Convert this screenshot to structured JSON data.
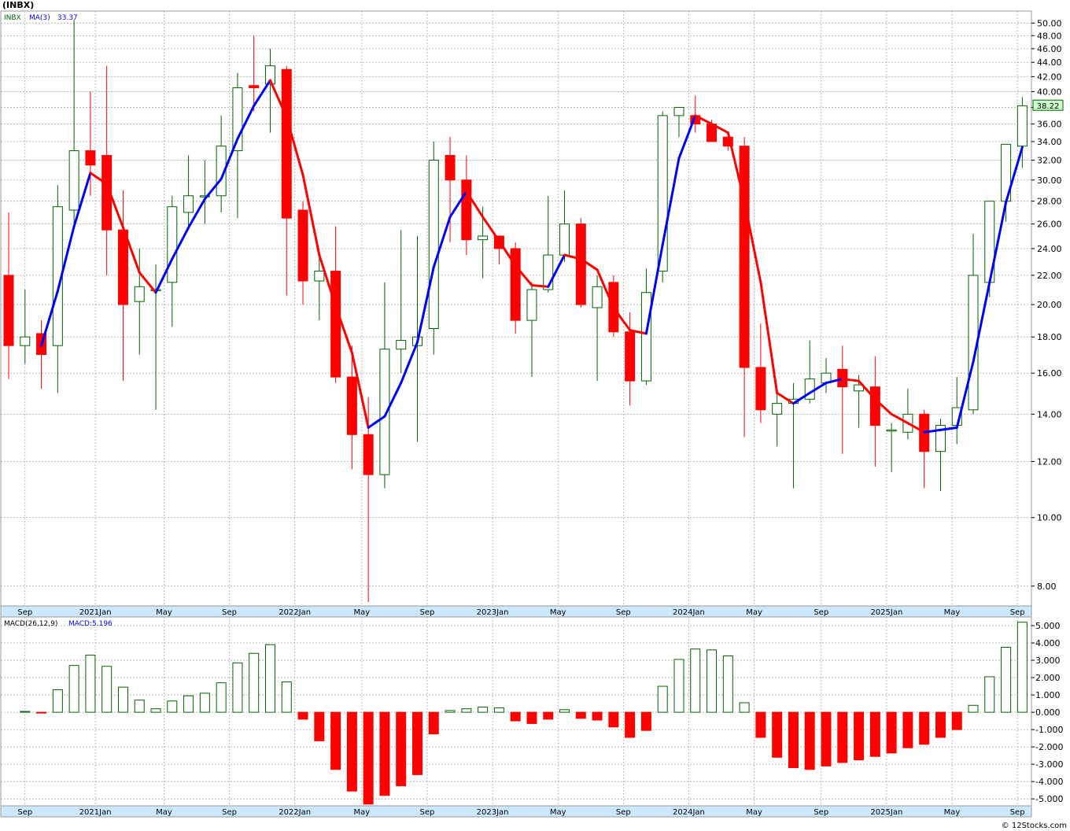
{
  "title": "(INBX)",
  "footer": "© 12Stocks.com",
  "price_panel": {
    "ticker": "INBX",
    "ma_label": "MA(3)",
    "ma_value": "33.37",
    "last_price": "38.22",
    "last_price_value": 38.22
  },
  "macd_panel": {
    "label": "MACD(26,12,9)",
    "value_label": "MACD:5.196"
  },
  "x_axis_labels": [
    {
      "label": "Sep",
      "index": 1
    },
    {
      "label": "2021Jan",
      "index": 5.3
    },
    {
      "label": "May",
      "index": 9.5
    },
    {
      "label": "Sep",
      "index": 13.5
    },
    {
      "label": "2022Jan",
      "index": 17.5
    },
    {
      "label": "May",
      "index": 21.6
    },
    {
      "label": "Sep",
      "index": 25.6
    },
    {
      "label": "2023Jan",
      "index": 29.6
    },
    {
      "label": "May",
      "index": 33.6
    },
    {
      "label": "Sep",
      "index": 37.6
    },
    {
      "label": "2024Jan",
      "index": 41.6
    },
    {
      "label": "May",
      "index": 45.6
    },
    {
      "label": "Sep",
      "index": 49.7
    },
    {
      "label": "2025Jan",
      "index": 53.7
    },
    {
      "label": "May",
      "index": 57.7
    },
    {
      "label": "Sep",
      "index": 61.7
    }
  ],
  "colors": {
    "up": "#006400",
    "down": "#ff0000",
    "ma_up": "#0000ff",
    "ma_down": "#ff0000",
    "grid": "#aaaaaa",
    "axis_band": "#cce8ff",
    "last_price_box": "#ccffcc"
  },
  "chart_data": [
    {
      "type": "candlestick",
      "title": "(INBX)",
      "y_scale": "log",
      "ylim": [
        7.5,
        52
      ],
      "yticks": [
        "8.00",
        "10.00",
        "12.00",
        "14.00",
        "16.00",
        "18.00",
        "20.00",
        "22.00",
        "24.00",
        "26.00",
        "28.00",
        "30.00",
        "32.00",
        "34.00",
        "36.00",
        "38.00",
        "40.00",
        "42.00",
        "44.00",
        "46.00",
        "48.00",
        "50.00"
      ],
      "grid": true,
      "candles": [
        {
          "o": 22.0,
          "h": 27.0,
          "l": 15.7,
          "c": 17.5
        },
        {
          "o": 17.5,
          "h": 21.0,
          "l": 16.5,
          "c": 18.0
        },
        {
          "o": 18.2,
          "h": 19.0,
          "l": 15.2,
          "c": 17.0
        },
        {
          "o": 17.5,
          "h": 29.5,
          "l": 15.0,
          "c": 27.5
        },
        {
          "o": 27.2,
          "h": 50.5,
          "l": 26.0,
          "c": 33.0
        },
        {
          "o": 33.0,
          "h": 40.0,
          "l": 28.5,
          "c": 31.5
        },
        {
          "o": 32.5,
          "h": 43.5,
          "l": 22.0,
          "c": 25.5
        },
        {
          "o": 25.5,
          "h": 29.0,
          "l": 15.6,
          "c": 20.0
        },
        {
          "o": 20.2,
          "h": 24.0,
          "l": 17.0,
          "c": 21.2
        },
        {
          "o": 21.0,
          "h": 22.8,
          "l": 14.2,
          "c": 21.0
        },
        {
          "o": 21.5,
          "h": 28.5,
          "l": 18.6,
          "c": 27.5
        },
        {
          "o": 27.0,
          "h": 32.5,
          "l": 25.5,
          "c": 28.5
        },
        {
          "o": 28.5,
          "h": 32.0,
          "l": 26.0,
          "c": 28.5
        },
        {
          "o": 28.5,
          "h": 37.0,
          "l": 27.0,
          "c": 33.5
        },
        {
          "o": 33.0,
          "h": 42.5,
          "l": 26.5,
          "c": 40.5
        },
        {
          "o": 40.8,
          "h": 48.0,
          "l": 37.5,
          "c": 40.5
        },
        {
          "o": 41.0,
          "h": 46.0,
          "l": 35.0,
          "c": 43.5
        },
        {
          "o": 43.0,
          "h": 43.5,
          "l": 20.6,
          "c": 26.5
        },
        {
          "o": 27.2,
          "h": 28.0,
          "l": 20.0,
          "c": 21.6
        },
        {
          "o": 21.6,
          "h": 23.5,
          "l": 19.0,
          "c": 22.3
        },
        {
          "o": 22.3,
          "h": 25.8,
          "l": 15.5,
          "c": 15.8
        },
        {
          "o": 15.8,
          "h": 17.5,
          "l": 11.7,
          "c": 13.1
        },
        {
          "o": 13.1,
          "h": 14.8,
          "l": 7.6,
          "c": 11.5
        },
        {
          "o": 11.5,
          "h": 21.5,
          "l": 11.0,
          "c": 17.3
        },
        {
          "o": 17.3,
          "h": 25.5,
          "l": 16.0,
          "c": 17.8
        },
        {
          "o": 17.5,
          "h": 25.0,
          "l": 12.8,
          "c": 18.0
        },
        {
          "o": 18.5,
          "h": 34.0,
          "l": 17.0,
          "c": 32.0
        },
        {
          "o": 32.5,
          "h": 34.5,
          "l": 24.5,
          "c": 30.0
        },
        {
          "o": 30.0,
          "h": 32.5,
          "l": 23.5,
          "c": 24.7
        },
        {
          "o": 24.7,
          "h": 27.5,
          "l": 21.8,
          "c": 25.0
        },
        {
          "o": 25.0,
          "h": 25.0,
          "l": 22.8,
          "c": 24.0
        },
        {
          "o": 24.0,
          "h": 24.5,
          "l": 18.2,
          "c": 19.0
        },
        {
          "o": 19.0,
          "h": 21.5,
          "l": 15.8,
          "c": 21.0
        },
        {
          "o": 21.0,
          "h": 28.5,
          "l": 20.8,
          "c": 23.5
        },
        {
          "o": 23.5,
          "h": 29.0,
          "l": 23.0,
          "c": 26.0
        },
        {
          "o": 26.0,
          "h": 26.5,
          "l": 19.8,
          "c": 20.0
        },
        {
          "o": 19.8,
          "h": 22.0,
          "l": 15.6,
          "c": 21.2
        },
        {
          "o": 21.5,
          "h": 22.0,
          "l": 18.0,
          "c": 18.3
        },
        {
          "o": 18.3,
          "h": 19.5,
          "l": 14.4,
          "c": 15.6
        },
        {
          "o": 15.6,
          "h": 22.5,
          "l": 15.4,
          "c": 20.8
        },
        {
          "o": 22.3,
          "h": 37.5,
          "l": 21.5,
          "c": 37.0
        },
        {
          "o": 37.0,
          "h": 38.0,
          "l": 34.5,
          "c": 38.0
        },
        {
          "o": 37.0,
          "h": 39.5,
          "l": 35.0,
          "c": 36.0
        },
        {
          "o": 36.0,
          "h": 36.5,
          "l": 34.0,
          "c": 34.0
        },
        {
          "o": 34.5,
          "h": 34.0,
          "l": 33.0,
          "c": 33.5
        },
        {
          "o": 33.5,
          "h": 34.5,
          "l": 13.0,
          "c": 16.3
        },
        {
          "o": 16.3,
          "h": 18.8,
          "l": 13.6,
          "c": 14.2
        },
        {
          "o": 14.0,
          "h": 15.0,
          "l": 12.6,
          "c": 14.5
        },
        {
          "o": 14.5,
          "h": 15.5,
          "l": 11.0,
          "c": 14.7
        },
        {
          "o": 14.7,
          "h": 17.8,
          "l": 14.5,
          "c": 15.7
        },
        {
          "o": 15.5,
          "h": 16.8,
          "l": 15.0,
          "c": 16.0
        },
        {
          "o": 16.2,
          "h": 17.5,
          "l": 12.3,
          "c": 15.3
        },
        {
          "o": 15.1,
          "h": 15.9,
          "l": 13.4,
          "c": 15.4
        },
        {
          "o": 15.3,
          "h": 16.9,
          "l": 11.8,
          "c": 13.5
        },
        {
          "o": 13.3,
          "h": 13.6,
          "l": 11.6,
          "c": 13.3
        },
        {
          "o": 13.2,
          "h": 15.2,
          "l": 12.9,
          "c": 14.0
        },
        {
          "o": 14.0,
          "h": 14.2,
          "l": 11.0,
          "c": 12.4
        },
        {
          "o": 12.4,
          "h": 13.8,
          "l": 10.9,
          "c": 13.5
        },
        {
          "o": 13.5,
          "h": 15.8,
          "l": 12.7,
          "c": 14.3
        },
        {
          "o": 14.2,
          "h": 25.2,
          "l": 14.0,
          "c": 22.0
        },
        {
          "o": 21.5,
          "h": 28.0,
          "l": 20.5,
          "c": 28.0
        },
        {
          "o": 28.0,
          "h": 33.7,
          "l": 26.2,
          "c": 33.7
        },
        {
          "o": 33.5,
          "h": 39.3,
          "l": 31.2,
          "c": 38.2
        }
      ],
      "ma_label": "MA(3)",
      "ma": [
        null,
        null,
        17.5,
        20.9,
        25.8,
        30.7,
        29.6,
        25.7,
        22.2,
        20.8,
        23.2,
        25.7,
        28.2,
        30.1,
        34.3,
        38.2,
        41.5,
        36.8,
        30.5,
        23.5,
        19.9,
        17.1,
        13.4,
        13.9,
        15.5,
        17.7,
        22.6,
        26.6,
        28.9,
        26.6,
        24.6,
        22.7,
        21.3,
        21.2,
        23.5,
        23.2,
        22.4,
        19.8,
        18.4,
        18.2,
        24.3,
        32.2,
        37.0,
        36.0,
        35.0,
        28.0,
        21.5,
        15.0,
        14.5,
        15.0,
        15.5,
        15.7,
        15.6,
        14.7,
        14.0,
        13.6,
        13.2,
        13.3,
        13.4,
        16.6,
        21.5,
        27.9,
        33.37
      ]
    },
    {
      "type": "bar",
      "title": "MACD(26,12,9)",
      "ylim": [
        -5.4,
        5.5
      ],
      "yticks": [
        "5.000",
        "4.000",
        "3.000",
        "2.000",
        "1.000",
        "0.000",
        "-1.000",
        "-2.000",
        "-3.000",
        "-4.000",
        "-5.000"
      ],
      "grid": true,
      "values": [
        null,
        0.05,
        -0.05,
        1.3,
        2.7,
        3.3,
        2.65,
        1.45,
        0.7,
        0.2,
        0.65,
        0.95,
        1.1,
        1.7,
        2.85,
        3.4,
        3.9,
        1.75,
        -0.4,
        -1.65,
        -3.3,
        -4.55,
        -5.3,
        -4.8,
        -4.25,
        -3.6,
        -1.25,
        0.1,
        0.2,
        0.3,
        0.25,
        -0.5,
        -0.65,
        -0.4,
        0.15,
        -0.35,
        -0.45,
        -0.85,
        -1.45,
        -1.05,
        1.5,
        3.05,
        3.65,
        3.6,
        3.25,
        0.55,
        -1.45,
        -2.6,
        -3.2,
        -3.3,
        -3.1,
        -2.9,
        -2.75,
        -2.55,
        -2.35,
        -2.05,
        -1.85,
        -1.45,
        -1.0,
        0.4,
        2.05,
        3.75,
        5.196
      ]
    }
  ]
}
